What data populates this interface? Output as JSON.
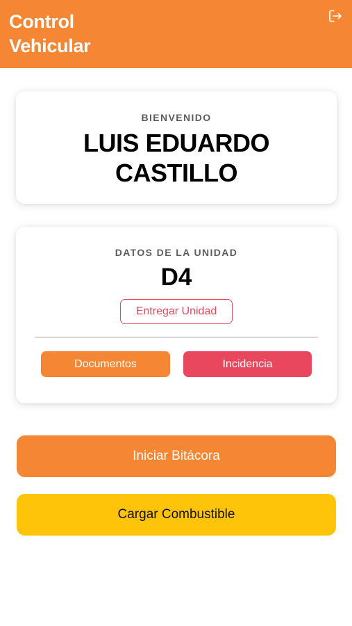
{
  "header": {
    "title": "Control Vehicular",
    "logout_icon": "logout-icon",
    "background_color": "#f58634"
  },
  "welcome": {
    "eyebrow": "BIENVENIDO",
    "user_name": "LUIS EDUARDO CASTILLO"
  },
  "unit": {
    "eyebrow": "DATOS DE LA UNIDAD",
    "code": "D4",
    "deliver_label": "Entregar Unidad",
    "documents_label": "Documentos",
    "incident_label": "Incidencia"
  },
  "actions": {
    "start_log_label": "Iniciar Bitácora",
    "load_fuel_label": "Cargar Combustible"
  },
  "colors": {
    "primary_orange": "#f58634",
    "danger_red": "#e8475e",
    "fuel_yellow": "#fdc409"
  }
}
